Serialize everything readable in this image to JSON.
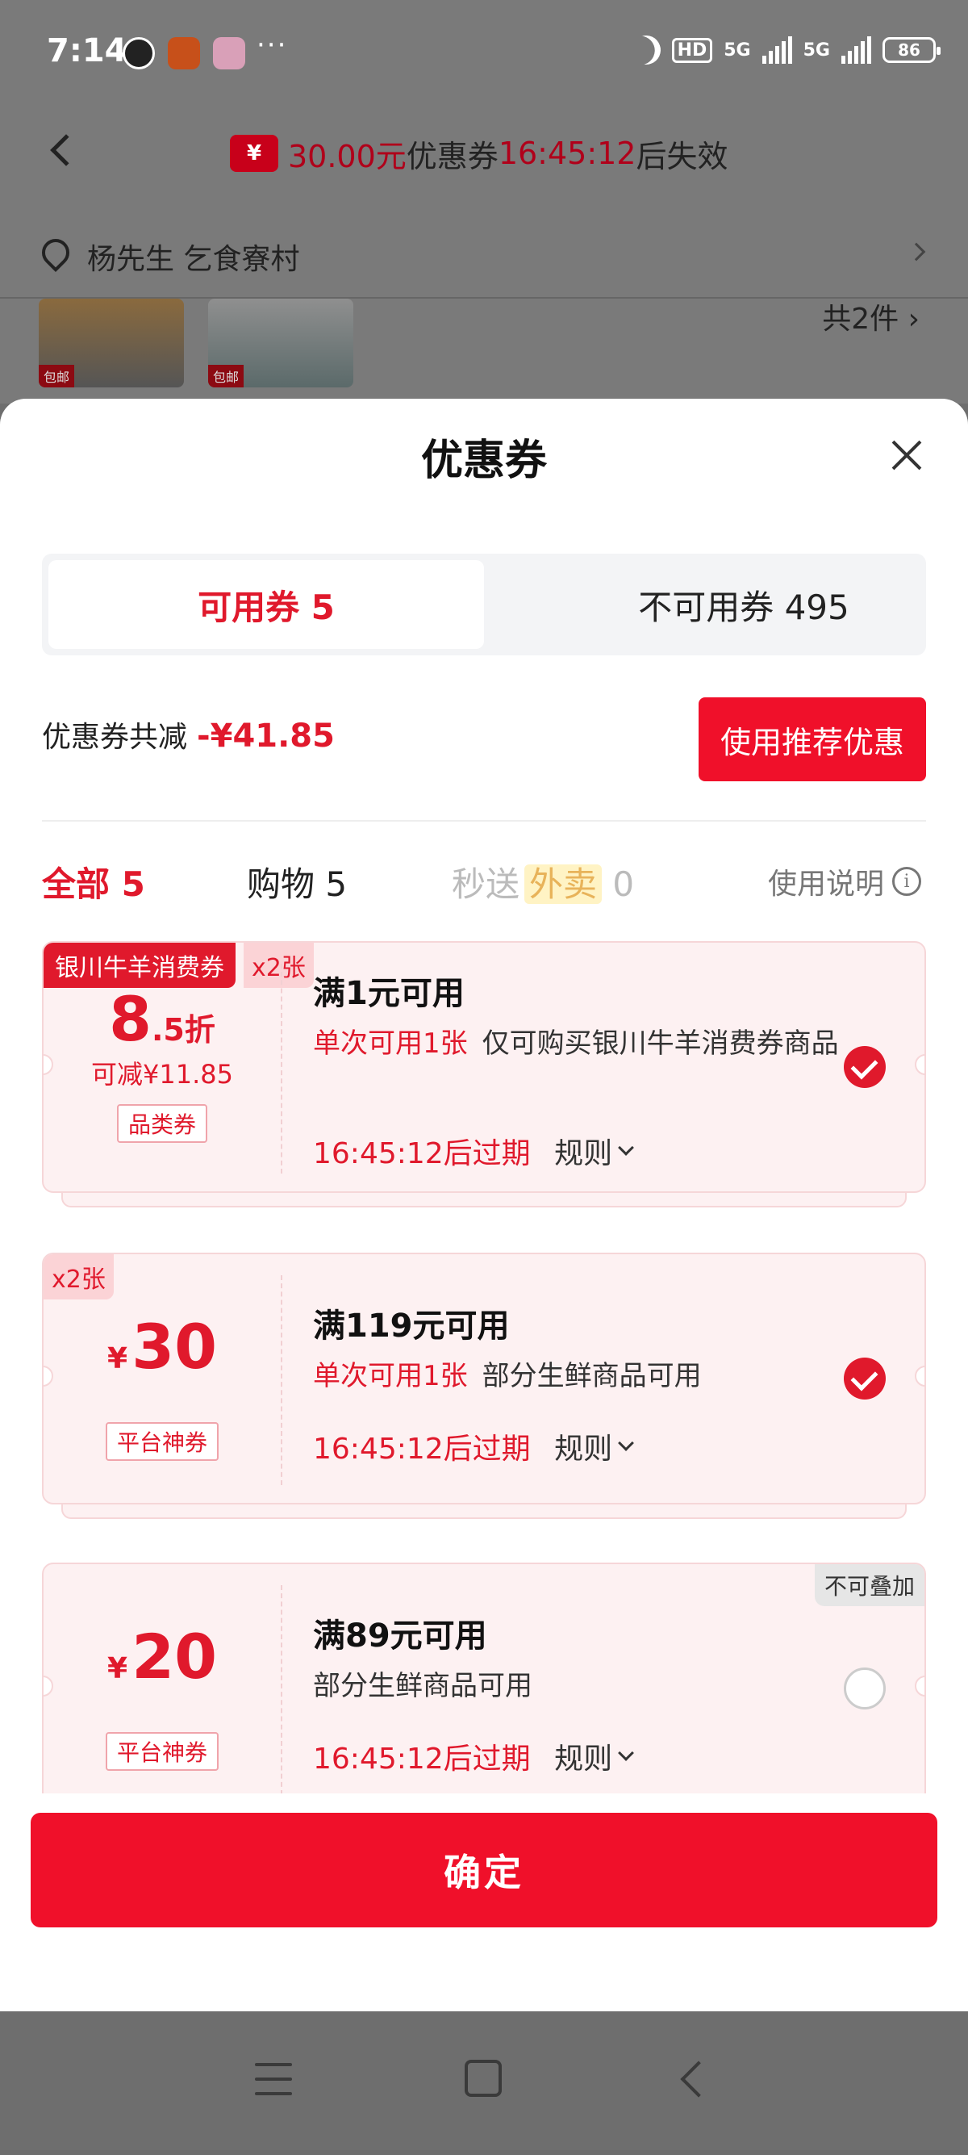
{
  "status": {
    "time": "7:14",
    "hd": "HD",
    "net1": "5G",
    "net2": "5G",
    "battery": "86"
  },
  "background": {
    "banner_amount": "30.00元",
    "banner_mid": "优惠券",
    "banner_time": "16:45:12",
    "banner_end": "后失效",
    "banner_icon_text": "¥",
    "address": "杨先生  乞食寮村",
    "thumb_tag": "包邮",
    "total_items": "共2件"
  },
  "sheet": {
    "title": "优惠券",
    "tabs": [
      {
        "label": "可用券 5"
      },
      {
        "label": "不可用券 495"
      }
    ],
    "savings_label": "优惠券共减",
    "savings_amount": "-¥41.85",
    "recommend_button": "使用推荐优惠",
    "filters": {
      "all": "全部 5",
      "shopping": "购物 5",
      "express_pre": "秒送",
      "express_tag": "外卖",
      "express_count": "0",
      "help": "使用说明",
      "help_icon": "i"
    },
    "coupons": [
      {
        "corner_tag": "银川牛羊消费券",
        "qty": "x2张",
        "discount_main": "8",
        "discount_sub": ".5折",
        "reduce": "可减¥11.85",
        "type": "品类券",
        "title": "满1元可用",
        "limit": "单次可用1张",
        "desc": "仅可购买银川牛羊消费券商品",
        "expire": "16:45:12后过期",
        "rule": "规则",
        "selected": true
      },
      {
        "qty": "x2张",
        "currency": "¥",
        "value": "30",
        "type": "平台神券",
        "title": "满119元可用",
        "limit": "单次可用1张",
        "desc": "部分生鲜商品可用",
        "expire": "16:45:12后过期",
        "rule": "规则",
        "selected": true
      },
      {
        "corner_note": "不可叠加",
        "currency": "¥",
        "value": "20",
        "type": "平台神券",
        "title": "满89元可用",
        "desc": "部分生鲜商品可用",
        "expire": "16:45:12后过期",
        "rule": "规则",
        "selected": false
      }
    ],
    "confirm": "确定"
  },
  "colors": {
    "accent": "#e0192c",
    "button": "#f0102a",
    "card_bg": "#fdf1f2"
  }
}
